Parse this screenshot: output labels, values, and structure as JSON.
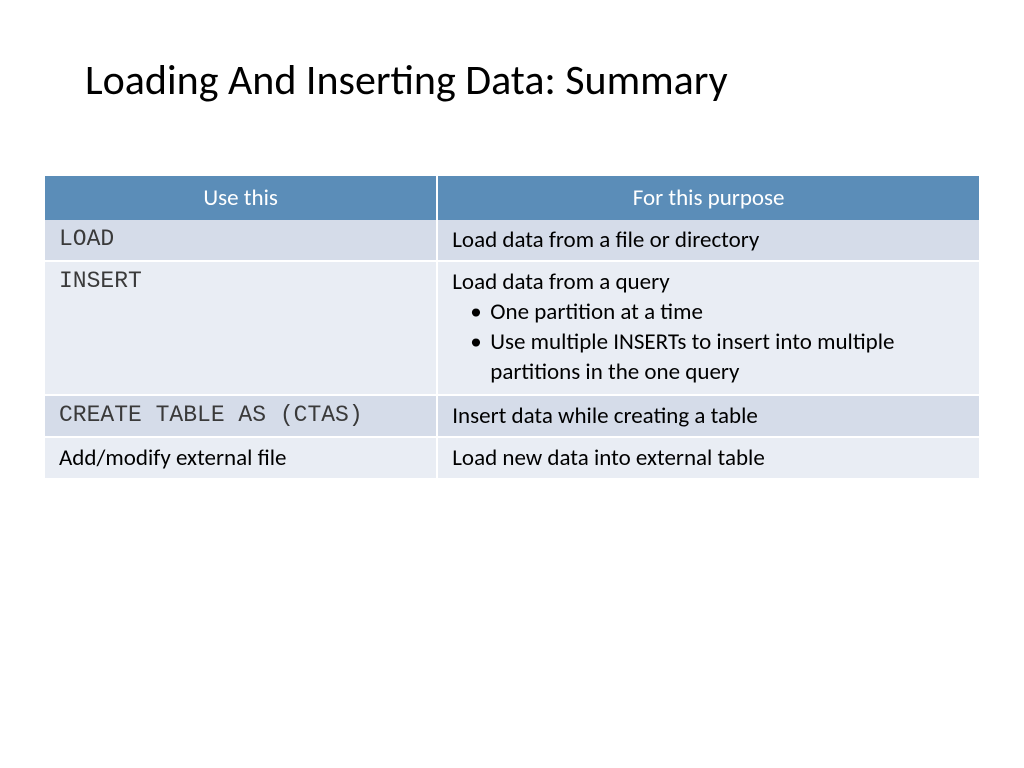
{
  "title": "Loading And Inserting Data: Summary",
  "chart_data": {
    "type": "table",
    "headers": [
      "Use this",
      "For this purpose"
    ],
    "rows": [
      {
        "use": "LOAD",
        "use_mono": true,
        "purpose_text": "Load data from a file or directory",
        "purpose_bullets": []
      },
      {
        "use": "INSERT",
        "use_mono": true,
        "purpose_text": "Load data from a query",
        "purpose_bullets": [
          "One partition at a time",
          "Use multiple INSERTs to insert into multiple partitions in the one query"
        ]
      },
      {
        "use": "CREATE TABLE AS (CTAS)",
        "use_mono": true,
        "purpose_text": "Insert data while creating a table",
        "purpose_bullets": []
      },
      {
        "use": "Add/modify external file",
        "use_mono": false,
        "purpose_text": "Load new data into external table",
        "purpose_bullets": []
      }
    ]
  }
}
